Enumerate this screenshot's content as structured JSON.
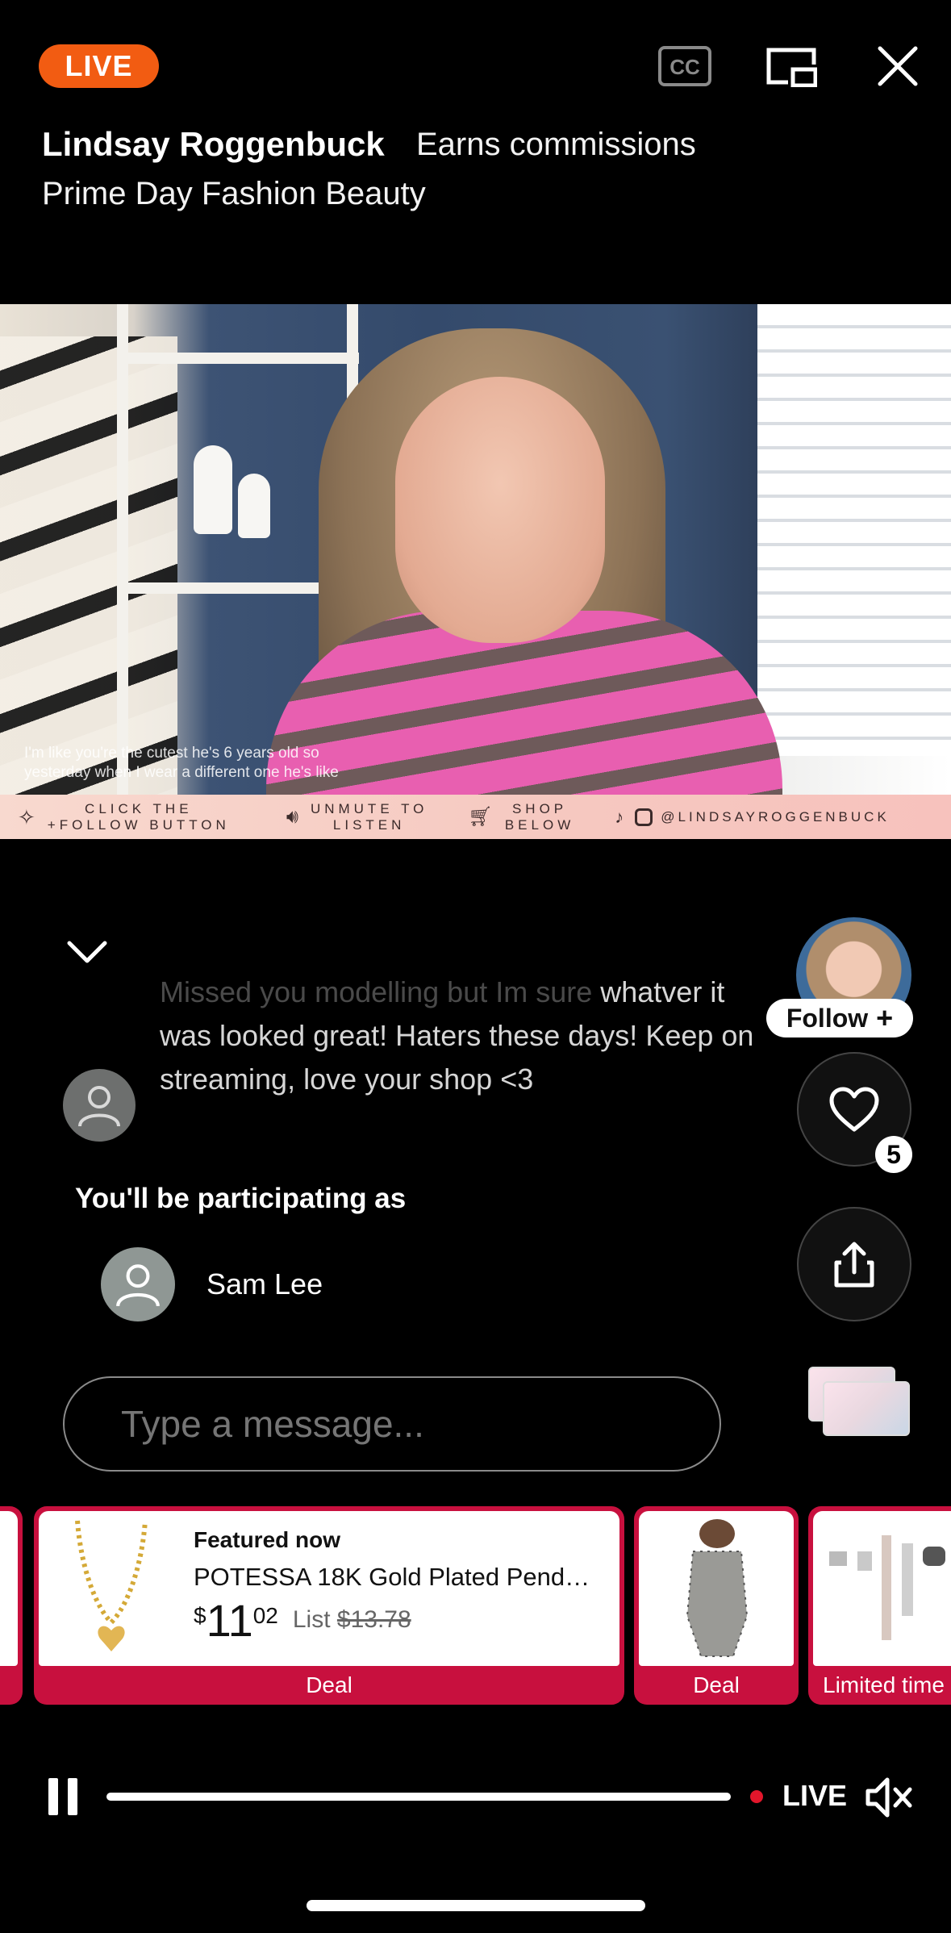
{
  "header": {
    "live_badge": "LIVE",
    "streamer_name": "Lindsay Roggenbuck",
    "commission_note": "Earns commissions",
    "stream_title": "Prime Day Fashion Beauty"
  },
  "video": {
    "caption_line1": "I'm like you're the cutest he's 6 years old so",
    "caption_line2": "yesterday when I wear a different one he's like",
    "promo": {
      "follow_line1": "CLICK THE",
      "follow_line2": "+FOLLOW BUTTON",
      "unmute_line1": "UNMUTE TO",
      "unmute_line2": "LISTEN",
      "shop_line1": "SHOP",
      "shop_line2": "BELOW",
      "handle": "@LINDSAYROGGENBUCK"
    }
  },
  "chat": {
    "message_faded": "Missed you modelling but Im sure",
    "message_rest": "whatver it was looked great! Haters these days! Keep on streaming, love your shop <3",
    "participating_label": "You'll be participating as",
    "participant_name": "Sam Lee",
    "input_placeholder": "Type a message..."
  },
  "rail": {
    "follow_label": "Follow",
    "like_count": "5"
  },
  "products": {
    "featured": {
      "label": "Featured now",
      "title": "POTESSA 18K Gold Plated Pend…",
      "currency": "$",
      "price_whole": "11",
      "price_fraction": "02",
      "list_label": "List",
      "list_price": "$13.78",
      "tag": "Deal"
    },
    "second": {
      "tag": "Deal"
    },
    "third": {
      "tag": "Limited time"
    }
  },
  "player": {
    "live_label": "LIVE"
  },
  "colors": {
    "live_orange": "#f25c12",
    "deal_red": "#c8103e",
    "live_dot": "#e2162b"
  }
}
